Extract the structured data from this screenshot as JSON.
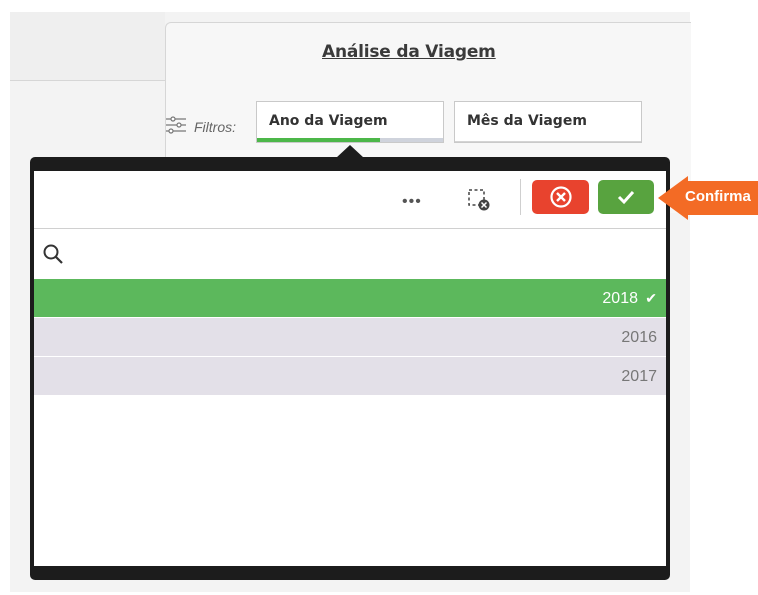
{
  "header": {
    "active_tab_title": "Análise da Viagem"
  },
  "filters": {
    "label": "Filtros:",
    "chips": [
      {
        "label": "Ano da Viagem",
        "selection_progress": 0.66
      },
      {
        "label": "Mês da Viagem"
      }
    ]
  },
  "popup": {
    "toolbar": {
      "more_icon": "ellipsis-icon",
      "clear_selection_icon": "clear-selection-icon",
      "cancel_icon": "close-icon",
      "confirm_icon": "check-icon"
    },
    "search": {
      "icon": "search-icon",
      "value": ""
    },
    "items": [
      {
        "label": "2018",
        "selected": true
      },
      {
        "label": "2016",
        "selected": false
      },
      {
        "label": "2017",
        "selected": false
      }
    ]
  },
  "callout": {
    "text": "Confirma"
  },
  "colors": {
    "selected_green": "#5cb85c",
    "confirm_green": "#58a33f",
    "cancel_red": "#e8432e",
    "callout_orange": "#f36b25",
    "popup_frame": "#1c1c1c",
    "unselected_row": "#e3e0e8"
  }
}
